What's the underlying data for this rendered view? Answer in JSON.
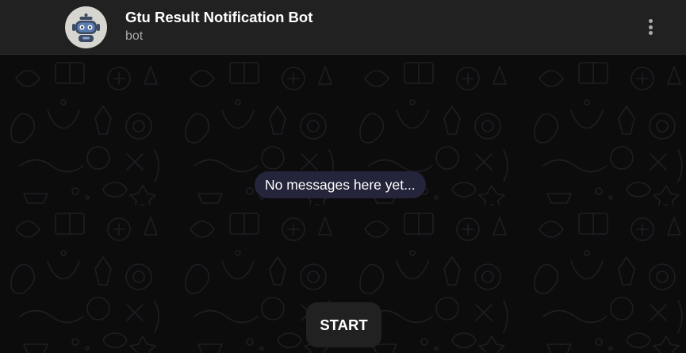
{
  "chat_header": {
    "title": "Gtu Result Notification Bot",
    "subtitle": "bot",
    "avatar_icon": "robot-icon",
    "menu_icon": "more-vertical-icon"
  },
  "chat_area": {
    "empty_message": "No messages here yet...",
    "start_button_label": "START"
  },
  "colors": {
    "header_bg": "#212121",
    "chat_bg": "#0c0c0c",
    "badge_bg": "#24243a",
    "text_primary": "#ffffff",
    "text_secondary": "#aaaaaa"
  }
}
